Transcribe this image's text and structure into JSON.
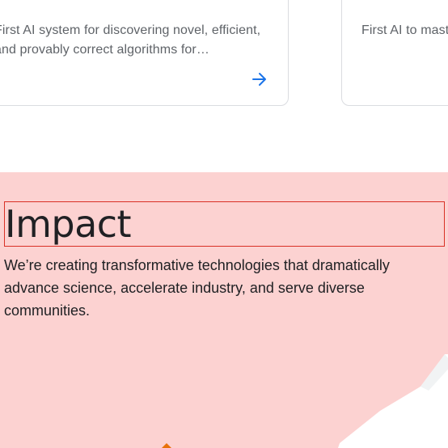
{
  "cards": [
    {
      "description": "First AI system for discovering novel, efficient, and provably correct algorithms for…",
      "arrow_icon": "arrow-right-icon"
    },
    {
      "description": "First AI to master the real-time strategy game StarCraft II, long…"
    }
  ],
  "impact": {
    "heading": "Impact",
    "body": "We’re creating transformative technologies that dramatically advance science, accelerate industry, and serve diverse communities."
  },
  "colors": {
    "impact_background": "#fcd2d1",
    "card_border": "#dadce0",
    "card_text": "#5f6368",
    "heading_text": "#202124",
    "link_blue": "#1a73e8",
    "highlight_outline": "#d93025"
  }
}
